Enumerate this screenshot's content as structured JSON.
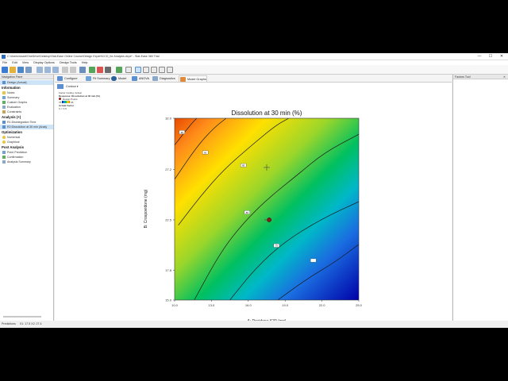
{
  "window": {
    "title": "C:\\Users\\stuart\\OneDrive\\Desktop\\Stat-Ease Online Course\\Design Expert\\CCD_for Analysis.dxpx* - Stat-Ease 360 Trial",
    "minimize": "—",
    "maximize": "☐",
    "close": "✕"
  },
  "menu": [
    "File",
    "Edit",
    "View",
    "Display Options",
    "Design Tools",
    "Help"
  ],
  "nav": {
    "header": "Navigation Pane",
    "design": "Design (Actual)",
    "information_title": "Information",
    "information_items": [
      "Notes",
      "Summary",
      "Custom Graphs",
      "Evaluation",
      "Constraints"
    ],
    "analysis_title": "Analysis (+)",
    "analysis_items": [
      "R1:Disintegration Time",
      "R2:Dissolution at 30 min (Analy"
    ],
    "optimization_title": "Optimization",
    "optimization_items": [
      "Numerical",
      "Graphical"
    ],
    "postanalysis_title": "Post Analysis",
    "postanalysis_items": [
      "Point Prediction",
      "Confirmation",
      "Analysis Summary"
    ]
  },
  "tabs": [
    "Configure",
    "Fit Summary",
    "Model",
    "ANOVA",
    "Diagnostics",
    "Model Graphs"
  ],
  "subtoolbar": {
    "contour": "Contour"
  },
  "info_panel": {
    "factor_coding": "Factor Coding: Actual",
    "response": "Response: Dissolution at 30 min (%)",
    "design_points": "Design Points",
    "low": "75",
    "high": "95",
    "actual_factor": "Actual Factor",
    "actual_value": "C = 3.5"
  },
  "parts": {
    "header": "Factors Tool"
  },
  "status": {
    "predictions": "Predictions",
    "coords": "X1: 17.5   X2: 27.4"
  },
  "colors": {
    "accent": "#2a6db5",
    "selected": "#cde3f7"
  },
  "chart_data": {
    "type": "contour",
    "title": "Dissolution at 30 min (%)",
    "xlabel": "A: Povidone K30 (mg)",
    "ylabel": "B: Crospovidone (mg)",
    "xlim": [
      10,
      25
    ],
    "ylim": [
      15,
      32
    ],
    "xticks": [
      "10.0",
      "13.0",
      "16.0",
      "19.0",
      "22.0",
      "25.0"
    ],
    "yticks": [
      "15.0",
      "17.8",
      "22.5",
      "27.2",
      "32.0"
    ],
    "contour_labels": [
      "95",
      "90",
      "85",
      "80",
      "75"
    ],
    "contours": [
      {
        "label": "95",
        "points": [
          [
            10,
            29.5
          ],
          [
            11.3,
            31.4
          ],
          [
            11.8,
            32
          ]
        ]
      },
      {
        "label": "90",
        "points": [
          [
            10,
            26.3
          ],
          [
            11.9,
            29.5
          ],
          [
            13.3,
            31.2
          ],
          [
            14.2,
            32
          ]
        ]
      },
      {
        "label": "85",
        "points": [
          [
            10.3,
            22.0
          ],
          [
            12.1,
            24.7
          ],
          [
            14.0,
            27.2
          ],
          [
            16.2,
            29.4
          ],
          [
            18.2,
            31.3
          ],
          [
            19.3,
            32
          ]
        ]
      },
      {
        "label": "80",
        "points": [
          [
            11.6,
            15.0
          ],
          [
            13.7,
            19.4
          ],
          [
            15.5,
            22.1
          ],
          [
            17.6,
            24.5
          ],
          [
            20.0,
            26.7
          ],
          [
            22.2,
            28.8
          ],
          [
            25.0,
            30.5
          ]
        ]
      },
      {
        "label": "75",
        "points": [
          [
            14.5,
            15.0
          ],
          [
            16.6,
            18.0
          ],
          [
            19.0,
            20.5
          ],
          [
            22.0,
            22.6
          ],
          [
            25.0,
            24.2
          ]
        ]
      },
      {
        "label": "",
        "points": [
          [
            18.4,
            15.0
          ],
          [
            20.8,
            17.0
          ],
          [
            23.0,
            18.5
          ],
          [
            25.0,
            20.2
          ]
        ]
      }
    ],
    "label_positions": [
      [
        10.6,
        30.7
      ],
      [
        12.5,
        28.8
      ],
      [
        15.6,
        27.6
      ],
      [
        15.9,
        23.2
      ],
      [
        18.3,
        20.1
      ],
      [
        21.3,
        18.7
      ]
    ],
    "design_points": [
      {
        "x": 17.7,
        "y": 22.5
      }
    ],
    "crosshair": {
      "x": 17.5,
      "y": 27.4
    }
  }
}
